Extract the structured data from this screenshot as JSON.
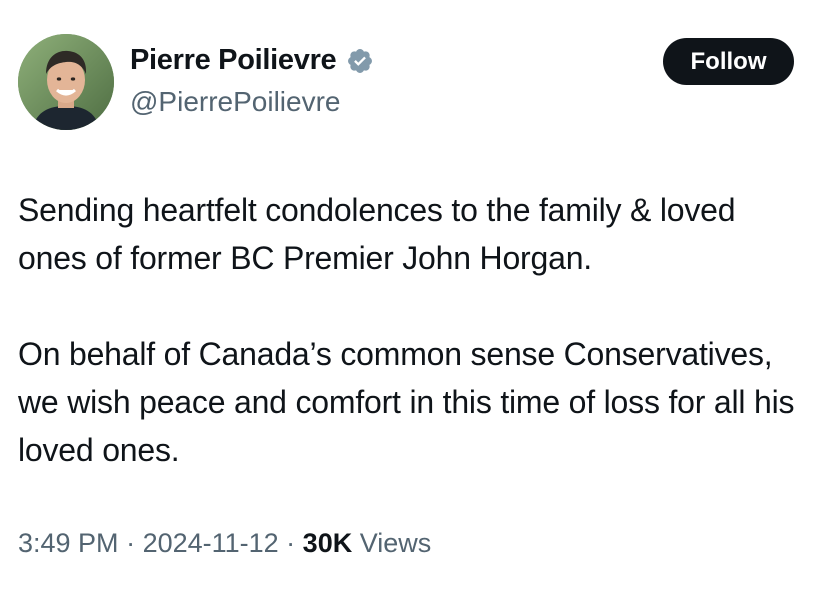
{
  "author": {
    "display_name": "Pierre Poilievre",
    "handle": "@PierrePoilievre",
    "verified_icon": "verified-badge-icon",
    "verified_color": "#829aab"
  },
  "actions": {
    "follow_label": "Follow"
  },
  "tweet": {
    "paragraphs": [
      "Sending heartfelt condolences to the family & loved ones of former BC Premier John Horgan.",
      "On behalf of Canada’s common sense Conservatives, we wish peace and comfort in this time of loss for all his loved ones."
    ]
  },
  "meta": {
    "time": "3:49 PM",
    "separator": " · ",
    "date": "2024-11-12",
    "views_count": "30K",
    "views_label": "Views"
  }
}
